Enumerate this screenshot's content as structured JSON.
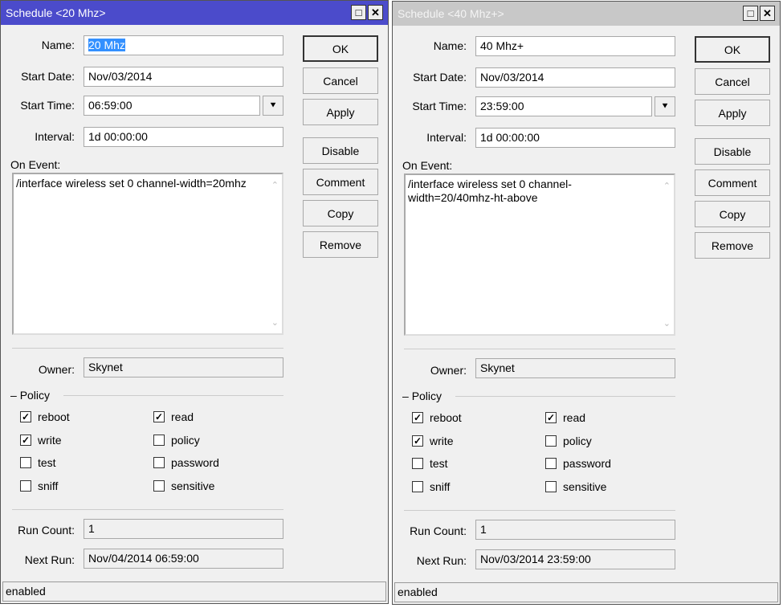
{
  "dialogs": [
    {
      "title": "Schedule <20 Mhz>",
      "name": "20 Mhz",
      "start_date": "Nov/03/2014",
      "start_time": "06:59:00",
      "interval": "1d 00:00:00",
      "on_event": "/interface wireless set 0 channel-width=20mhz",
      "owner": "Skynet",
      "run_count": "1",
      "next_run": "Nov/04/2014 06:59:00",
      "status": "enabled",
      "policy": [
        {
          "label": "reboot",
          "checked": true
        },
        {
          "label": "read",
          "checked": true
        },
        {
          "label": "write",
          "checked": true
        },
        {
          "label": "policy",
          "checked": false
        },
        {
          "label": "test",
          "checked": false
        },
        {
          "label": "password",
          "checked": false
        },
        {
          "label": "sniff",
          "checked": false
        },
        {
          "label": "sensitive",
          "checked": false
        }
      ]
    },
    {
      "title": "Schedule <40 Mhz+>",
      "name": "40 Mhz+",
      "start_date": "Nov/03/2014",
      "start_time": "23:59:00",
      "interval": "1d 00:00:00",
      "on_event": "/interface wireless set 0 channel-width=20/40mhz-ht-above",
      "owner": "Skynet",
      "run_count": "1",
      "next_run": "Nov/03/2014 23:59:00",
      "status": "enabled",
      "policy": [
        {
          "label": "reboot",
          "checked": true
        },
        {
          "label": "read",
          "checked": true
        },
        {
          "label": "write",
          "checked": true
        },
        {
          "label": "policy",
          "checked": false
        },
        {
          "label": "test",
          "checked": false
        },
        {
          "label": "password",
          "checked": false
        },
        {
          "label": "sniff",
          "checked": false
        },
        {
          "label": "sensitive",
          "checked": false
        }
      ]
    }
  ],
  "labels": {
    "name": "Name:",
    "start_date": "Start Date:",
    "start_time": "Start Time:",
    "interval": "Interval:",
    "on_event": "On Event:",
    "owner": "Owner:",
    "policy": "Policy",
    "run_count": "Run Count:",
    "next_run": "Next Run:"
  },
  "buttons": {
    "ok": "OK",
    "cancel": "Cancel",
    "apply": "Apply",
    "disable": "Disable",
    "comment": "Comment",
    "copy": "Copy",
    "remove": "Remove"
  },
  "icons": {
    "maximize": "□",
    "close": "✕",
    "dropdown": "⯆",
    "check": "✓"
  }
}
